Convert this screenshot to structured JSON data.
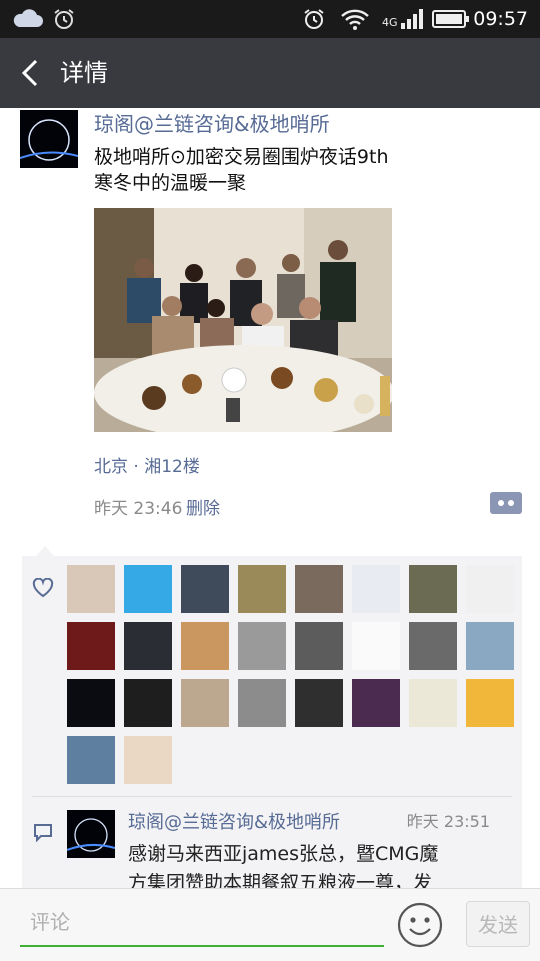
{
  "status_bar": {
    "time": "09:57",
    "network": "4G",
    "icons": [
      "cloud-icon",
      "alarm-icon",
      "alarm-icon",
      "wifi-icon",
      "signal-icon",
      "battery-icon"
    ]
  },
  "header": {
    "title": "详情",
    "back_icon": "back-arrow-icon"
  },
  "post": {
    "author": "琼阁@兰链咨询&极地哨所",
    "text_lines": [
      "极地哨所⊙加密交易圈围炉夜话9th",
      "寒冬中的温暖一聚"
    ],
    "location": "北京 · 湘12楼",
    "timestamp": "昨天 23:46",
    "delete_label": "删除",
    "more_icon": "more-actions-icon"
  },
  "likes": {
    "icon": "heart-icon",
    "count": 26
  },
  "comments": [
    {
      "author": "琼阁@兰链咨询&极地哨所",
      "time": "昨天 23:51",
      "text_lines": [
        "感谢马来西亚james张总，暨CMG魔",
        "方集团赞助本期餐叙五粮液一尊，发"
      ]
    }
  ],
  "input_bar": {
    "placeholder": "评论",
    "emoji_icon": "emoji-icon",
    "send_label": "发送"
  },
  "colors": {
    "status_bar_bg": "#1a1a1a",
    "title_bar_bg": "#393a3f",
    "link_blue": "#576b95",
    "accent_green": "#3cb035",
    "panel_bg": "#f3f3f5"
  }
}
